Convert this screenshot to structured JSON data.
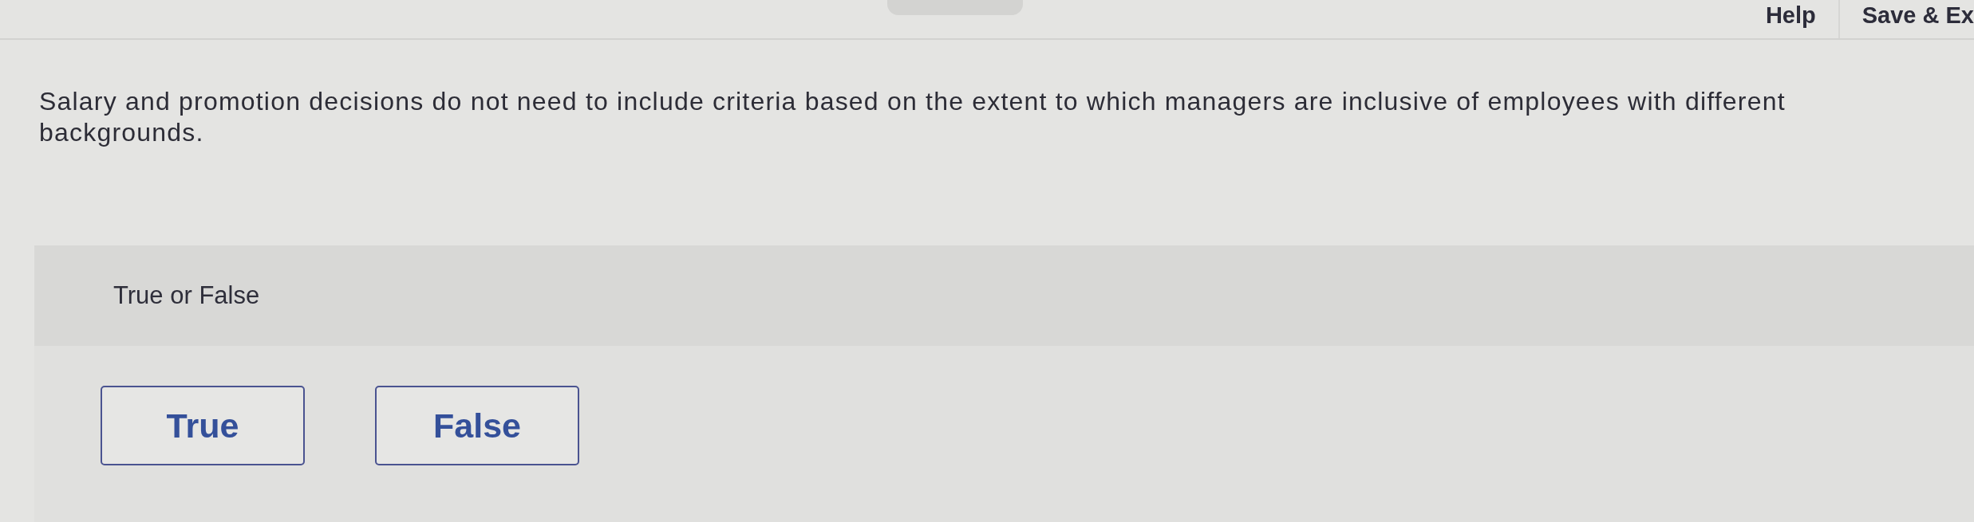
{
  "header": {
    "links": [
      {
        "label": "Help"
      },
      {
        "label": "Save & Ex"
      }
    ]
  },
  "question": {
    "text": "Salary and promotion decisions do not need to include criteria based on the extent to which managers are inclusive of employees with different backgrounds.",
    "prompt": "True or False",
    "options": [
      {
        "label": "True",
        "selected": false
      },
      {
        "label": "False",
        "selected": false
      }
    ]
  }
}
